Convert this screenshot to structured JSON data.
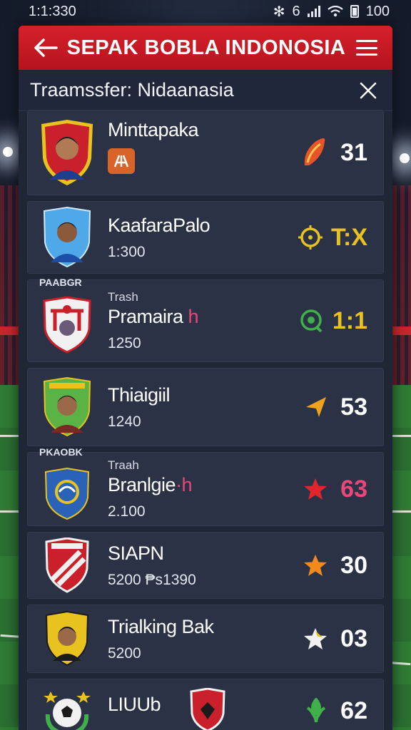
{
  "status_bar": {
    "time": "1:1:330",
    "bt": "✻",
    "net": "6",
    "battery": "100"
  },
  "header": {
    "title": "SEPAK BOBLA INDONOSIA"
  },
  "sub_header": {
    "title": "Traamssfer: Nidaanasia"
  },
  "colors": {
    "header_red": "#c8192a",
    "card_bg": "#2b3245",
    "accent_pink": "#e8477a",
    "gold": "#e8c21f"
  },
  "cards": [
    {
      "name": "Minttapaka",
      "value": "",
      "tag": "",
      "crest_tag": "",
      "stat": "31",
      "stat_icon": "flame-icon",
      "stat_color": "#ffffff"
    },
    {
      "name": "KaafaraPalo",
      "value": "1:300",
      "tag": "",
      "crest_tag": "",
      "stat": "T:X",
      "stat_icon": "target-icon",
      "stat_color": "#e8c21f"
    },
    {
      "name": "Pramaira",
      "name_accent": " h",
      "value": "1250",
      "tag": "Trash",
      "crest_tag": "PAABGR",
      "stat": "1:1",
      "stat_icon": "whistle-icon",
      "stat_color": "#e8c21f"
    },
    {
      "name": "Thiaigiil",
      "value": "1240",
      "tag": "",
      "crest_tag": "",
      "stat": "53",
      "stat_icon": "arrow-icon",
      "stat_color": "#ffffff"
    },
    {
      "name": "Branlgie",
      "name_accent": "·h",
      "value": "2.100",
      "tag": "Traah",
      "crest_tag": "PKAOBK",
      "stat": "63",
      "stat_icon": "star-icon",
      "stat_color": "#e8477a"
    },
    {
      "name": "SIAPN",
      "value": "5200 ₱s1390",
      "tag": "",
      "crest_tag": "",
      "stat": "30",
      "stat_icon": "star-icon",
      "stat_color": "#ffffff"
    },
    {
      "name": "Trialking Bak",
      "value": "5200",
      "tag": "",
      "crest_tag": "",
      "stat": "03",
      "stat_icon": "star-icon",
      "stat_color": "#ffffff"
    },
    {
      "name": "LIUUb",
      "value": "",
      "tag": "",
      "crest_tag": "",
      "stat": "62",
      "stat_icon": "leaf-icon",
      "stat_color": "#ffffff"
    }
  ]
}
